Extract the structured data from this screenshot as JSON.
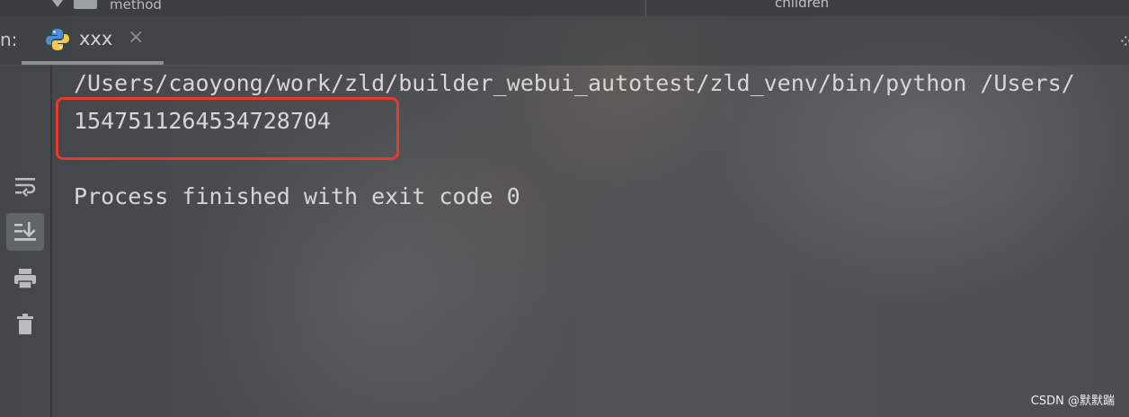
{
  "top": {
    "project_item": "method",
    "right_item": "children"
  },
  "tabbar": {
    "run_label": "n:",
    "tab": {
      "title": "xxx",
      "close": "×"
    }
  },
  "console": {
    "command_line": "/Users/caoyong/work/zld/builder_webui_autotest/zld_venv/bin/python /Users/",
    "output_value": "1547511264534728704",
    "exit_message": "Process finished with exit code 0"
  },
  "toolbar": {
    "buttons": [
      "soft-wrap",
      "scroll-to-end",
      "print",
      "clear-all"
    ]
  },
  "colors": {
    "highlight_border": "#e53a2c",
    "text": "#d6d6d6"
  },
  "watermark": "CSDN @默默踹"
}
